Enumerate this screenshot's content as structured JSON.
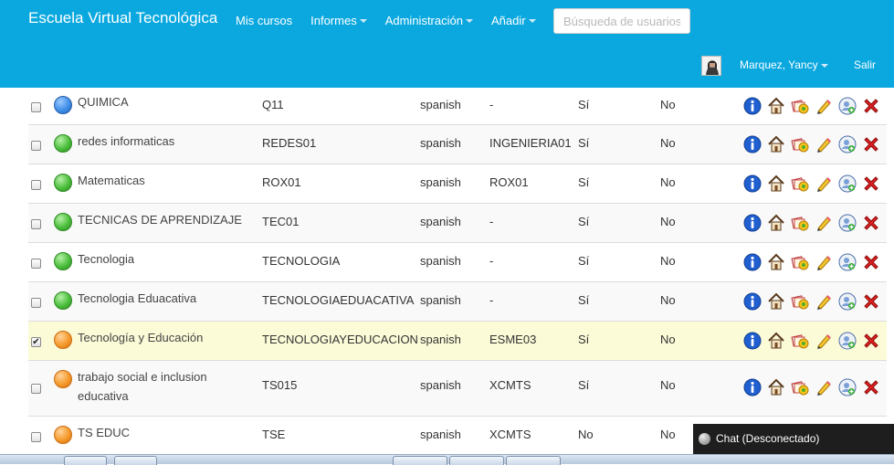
{
  "header": {
    "brand": "Escuela Virtual Tecnológica",
    "menu": [
      {
        "label": "Mis cursos",
        "dropdown": false
      },
      {
        "label": "Informes",
        "dropdown": true
      },
      {
        "label": "Administración",
        "dropdown": true
      },
      {
        "label": "Añadir",
        "dropdown": true
      }
    ],
    "search_placeholder": "Búsqueda de usuarios",
    "user_name": "Marquez, Yancy",
    "logout": "Salir",
    "bg_color": "#0aa8df"
  },
  "courses": [
    {
      "name": "QUIMICA",
      "code": "Q11",
      "language": "spanish",
      "category": "-",
      "visible": "Sí",
      "subscription": "No",
      "status_icon": "blue",
      "checked": false
    },
    {
      "name": "redes informaticas",
      "code": "REDES01",
      "language": "spanish",
      "category": "INGENIERIA01",
      "visible": "Sí",
      "subscription": "No",
      "status_icon": "green",
      "checked": false
    },
    {
      "name": "Matematicas",
      "code": "ROX01",
      "language": "spanish",
      "category": "ROX01",
      "visible": "Sí",
      "subscription": "No",
      "status_icon": "green",
      "checked": false
    },
    {
      "name": "TECNICAS DE APRENDIZAJE",
      "code": "TEC01",
      "language": "spanish",
      "category": "-",
      "visible": "Sí",
      "subscription": "No",
      "status_icon": "green",
      "checked": false
    },
    {
      "name": "Tecnologia",
      "code": "TECNOLOGIA",
      "language": "spanish",
      "category": "-",
      "visible": "Sí",
      "subscription": "No",
      "status_icon": "green",
      "checked": false
    },
    {
      "name": "Tecnologia Eduacativa",
      "code": "TECNOLOGIAEDUACATIVA",
      "language": "spanish",
      "category": "-",
      "visible": "Sí",
      "subscription": "No",
      "status_icon": "green",
      "checked": false
    },
    {
      "name": "Tecnología y Educación",
      "code": "TECNOLOGIAYEDUCACION",
      "language": "spanish",
      "category": "ESME03",
      "visible": "Sí",
      "subscription": "No",
      "status_icon": "orange",
      "checked": true
    },
    {
      "name": "trabajo social e inclusion educativa",
      "code": "TS015",
      "language": "spanish",
      "category": "XCMTS",
      "visible": "Sí",
      "subscription": "No",
      "status_icon": "orange",
      "checked": false
    },
    {
      "name": "TS EDUC",
      "code": "TSE",
      "language": "spanish",
      "category": "XCMTS",
      "visible": "No",
      "subscription": "No",
      "status_icon": "orange",
      "checked": false
    }
  ],
  "row_actions": [
    "info-icon",
    "home-icon",
    "maintenance-icon",
    "edit-pencil-icon",
    "add-user-icon",
    "delete-icon"
  ],
  "chat": {
    "label": "Chat (Desconectado)"
  }
}
